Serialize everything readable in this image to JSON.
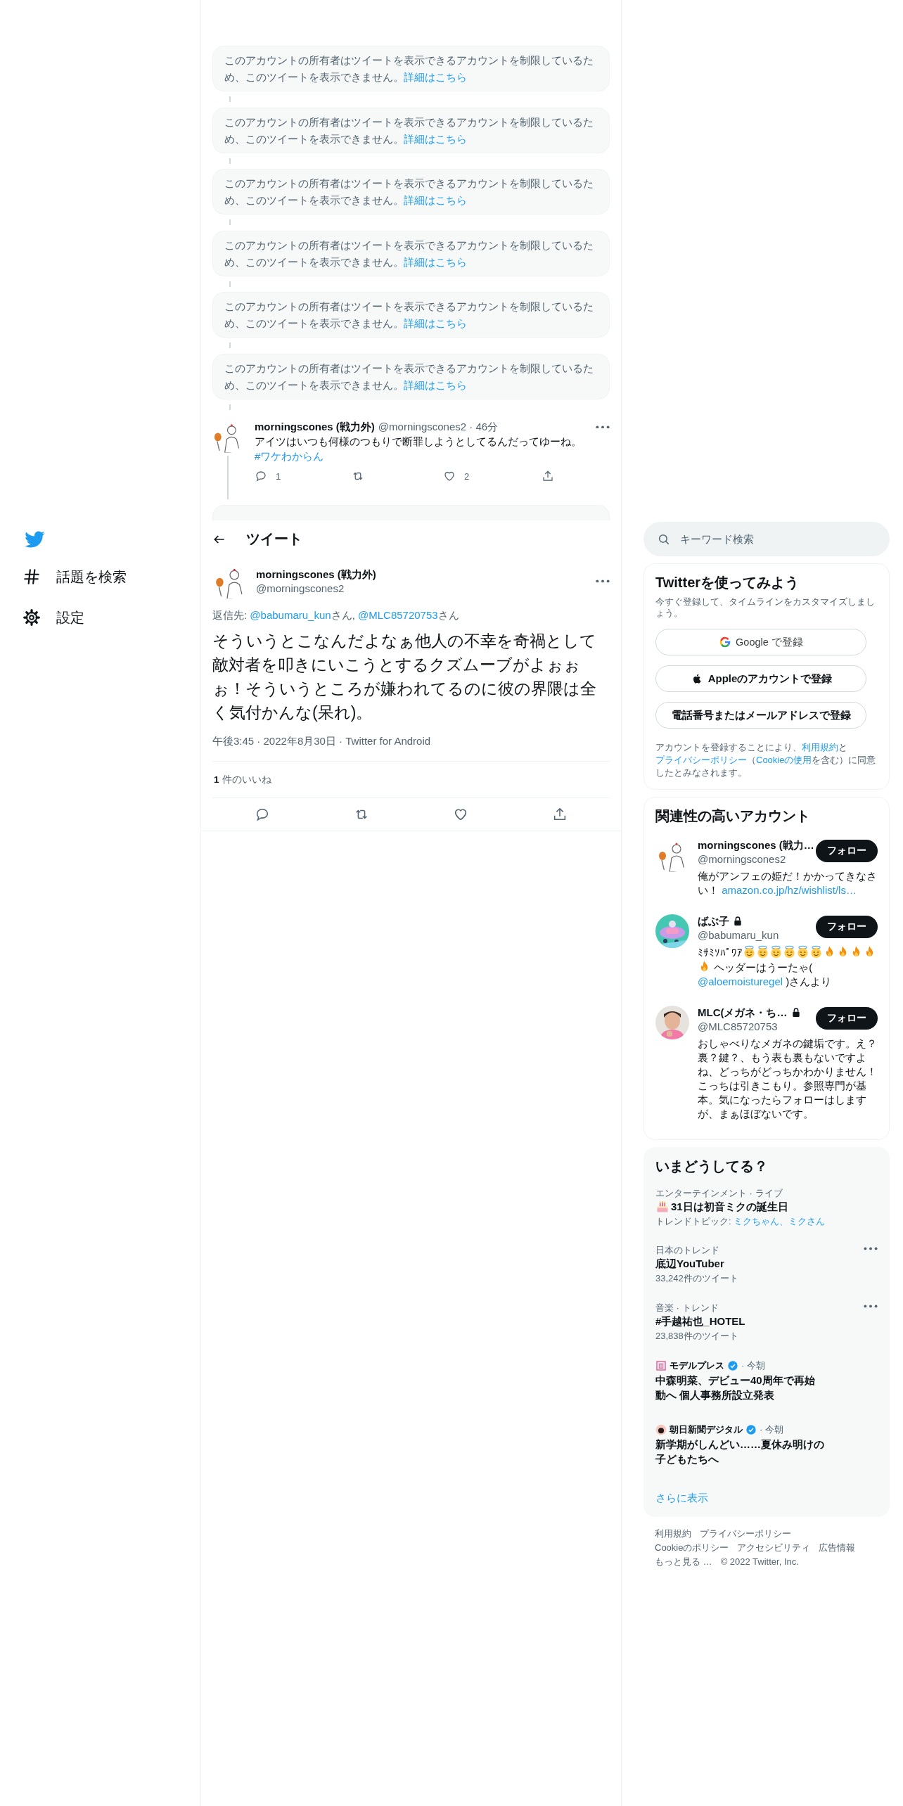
{
  "sidebar": {
    "items": [
      {
        "label": "話題を検索"
      },
      {
        "label": "設定"
      }
    ]
  },
  "timeline": {
    "unavailable": [
      {
        "text": "このアカウントの所有者はツイートを表示できるアカウントを制限しているため、このツイートを表示できません。",
        "link": "詳細はこちら"
      },
      {
        "text": "このアカウントの所有者はツイートを表示できるアカウントを制限しているため、このツイートを表示できません。",
        "link": "詳細はこちら"
      },
      {
        "text": "このアカウントの所有者はツイートを表示できるアカウントを制限しているため、このツイートを表示できません。",
        "link": "詳細はこちら"
      },
      {
        "text": "このアカウントの所有者はツイートを表示できるアカウントを制限しているため、このツイートを表示できません。",
        "link": "詳細はこちら"
      },
      {
        "text": "このアカウントの所有者はツイートを表示できるアカウントを制限しているため、このツイートを表示できません。",
        "link": "詳細はこちら"
      },
      {
        "text": "このアカウントの所有者はツイートを表示できるアカウントを制限しているため、このツイートを表示できません。",
        "link": "詳細はこちら"
      }
    ],
    "reply": {
      "name": "morningscones (戦力外)",
      "meta": "@morningscones2 · 46分",
      "text": "アイツはいつも何様のつもりで断罪しようとしてるんだってゆーね。",
      "hashtag": "#ワケわからん",
      "replies": "1",
      "likes": "2"
    }
  },
  "header": {
    "title": "ツイート"
  },
  "tweet": {
    "name": "morningscones (戦力外)",
    "handle": "@morningscones2",
    "reply_prefix": "返信先:",
    "reply_to": [
      {
        "handle": "@babumaru_kun",
        "suffix": "さん,"
      },
      {
        "handle": "@MLC85720753",
        "suffix": "さん"
      }
    ],
    "text": "そういうとこなんだよなぁ他人の不幸を奇禍として敵対者を叩きにいこうとするクズムーブがよぉぉぉ！そういうところが嫌われてるのに彼の界隈は全く気付かんな(呆れ)。",
    "meta": "午後3:45 · 2022年8月30日 · Twitter for Android",
    "like_count": "1",
    "like_label": "件のいいね"
  },
  "search": {
    "placeholder": "キーワード検索"
  },
  "signup": {
    "title": "Twitterを使ってみよう",
    "subtitle": "今すぐ登録して、タイムラインをカスタマイズしましょう。",
    "buttons": [
      {
        "kind": "google",
        "label": "Google で登録"
      },
      {
        "kind": "apple",
        "label": "Appleのアカウントで登録"
      },
      {
        "kind": "phone",
        "label": "電話番号またはメールアドレスで登録"
      }
    ],
    "legal": [
      {
        "kind": "text",
        "text": "アカウントを登録することにより、"
      },
      {
        "kind": "link",
        "text": "利用規約"
      },
      {
        "kind": "text",
        "text": "と"
      },
      {
        "kind": "link",
        "text": "プライバシーポリシー"
      },
      {
        "kind": "text",
        "text": "（"
      },
      {
        "kind": "link",
        "text": "Cookieの使用"
      },
      {
        "kind": "text",
        "text": "を含む）に同意したとみなされます。"
      }
    ]
  },
  "related": {
    "title": "関連性の高いアカウント",
    "accounts": [
      {
        "name": "morningscones (戦力…",
        "handle": "@morningscones2",
        "locked": false,
        "follow": "フォロー",
        "bio": [
          {
            "kind": "text",
            "text": "俺がアンフェの姫だ！かかってきなさい！ "
          },
          {
            "kind": "link",
            "text": "amazon.co.jp/hz/wishlist/ls…"
          }
        ]
      },
      {
        "name": "ばぶ子",
        "handle": "@babumaru_kun",
        "locked": true,
        "follow": "フォロー",
        "bio": [
          {
            "kind": "text",
            "text": "ﾐｻﾐｿﾊﾟﾜｱ"
          },
          {
            "kind": "halo"
          },
          {
            "kind": "halo"
          },
          {
            "kind": "halo"
          },
          {
            "kind": "halo"
          },
          {
            "kind": "halo"
          },
          {
            "kind": "halo"
          },
          {
            "kind": "fire"
          },
          {
            "kind": "fire"
          },
          {
            "kind": "fire"
          },
          {
            "kind": "fire"
          },
          {
            "kind": "fire"
          },
          {
            "kind": "text",
            "text": " ヘッダーはうーたゃ( "
          },
          {
            "kind": "link",
            "text": "@aloemoisturegel"
          },
          {
            "kind": "text",
            "text": " )さんより"
          }
        ]
      },
      {
        "name": "MLC(メガネ・ち…",
        "handle": "@MLC85720753",
        "locked": true,
        "follow": "フォロー",
        "bio": [
          {
            "kind": "text",
            "text": "おしゃべりなメガネの鍵垢です。え？裏？鍵？、もう表も裏もないですよね、どっちがどっちかわかりません！こっちは引きこもり。参照専門が基本。気になったらフォローはしますが、まぁほぼないです。"
          }
        ]
      }
    ]
  },
  "trends": {
    "title": "いまどうしてる？",
    "items": [
      {
        "kind": "event",
        "context": "エンターテインメント · ライブ",
        "title": "31日は初音ミクの誕生日",
        "topics_label": "トレンドトピック:",
        "topics": "ミクちゃん、ミクさん"
      },
      {
        "kind": "trend",
        "context": "日本のトレンド",
        "title": "底辺YouTuber",
        "count": "33,242件のツイート"
      },
      {
        "kind": "trend",
        "context": "音楽 · トレンド",
        "title": "#手越祐也_HOTEL",
        "count": "23,838件のツイート"
      },
      {
        "kind": "news",
        "source": "モデルプレス",
        "verified": true,
        "time": "· 今朝",
        "title": "中森明菜、デビュー40周年で再始動へ 個人事務所設立発表"
      },
      {
        "kind": "news",
        "source": "朝日新聞デジタル",
        "verified": true,
        "time": "· 今朝",
        "title": "新学期がしんどい……夏休み明けの子どもたちへ"
      }
    ],
    "more": "さらに表示"
  },
  "footer": {
    "links": [
      "利用規約",
      "プライバシーポリシー",
      "Cookieのポリシー",
      "アクセシビリティ",
      "広告情報",
      "もっと見る …"
    ],
    "copyright": "© 2022 Twitter, Inc."
  }
}
